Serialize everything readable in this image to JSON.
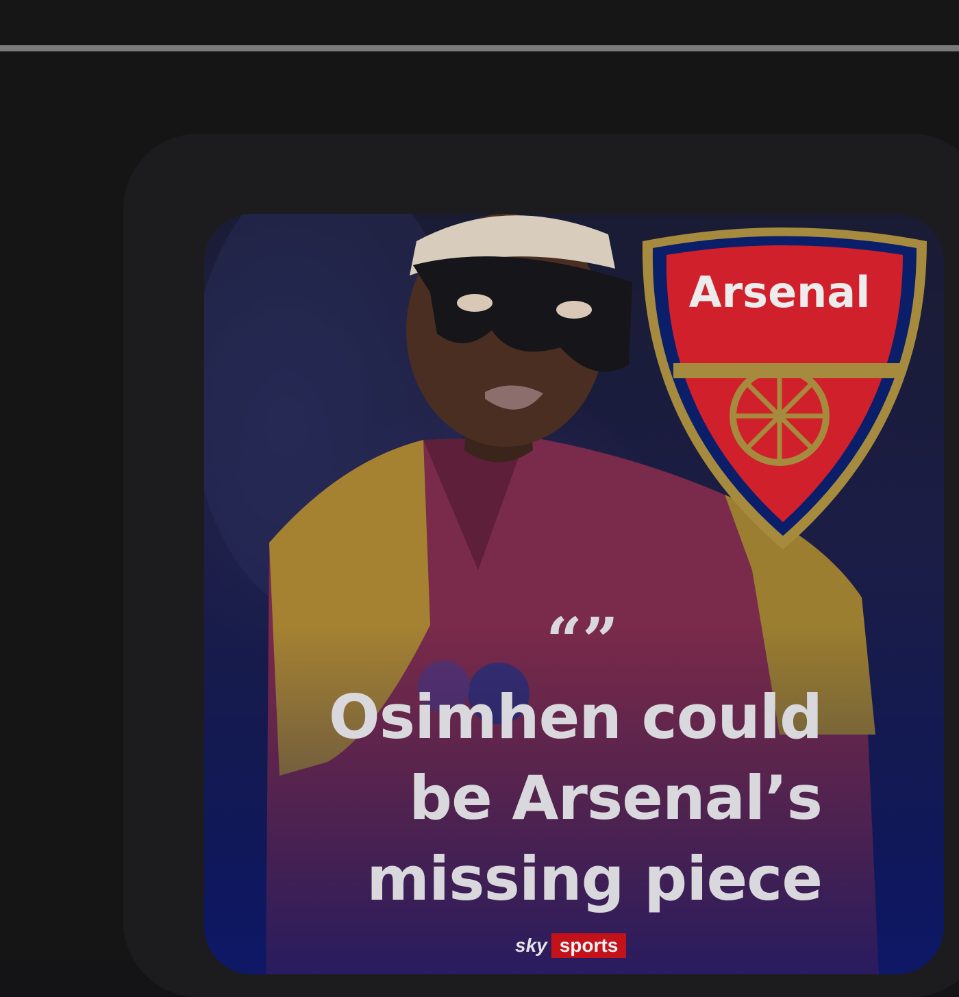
{
  "post": {
    "image": {
      "crest_text": "Arsenal",
      "quote_mark": "“”",
      "headline_lines": [
        "Osimhen could",
        "be Arsenal’s",
        "missing piece"
      ],
      "brand": {
        "sky": "sky",
        "sports": "sports"
      }
    }
  },
  "colors": {
    "page_background": "#141416",
    "card_background": "#1c1c1e",
    "crest_red": "#d0202b",
    "crest_navy": "#0b1e6a",
    "crest_gold": "#a68b3e",
    "headline_text": "#d9d9dd",
    "brand_red": "#c4121a"
  }
}
